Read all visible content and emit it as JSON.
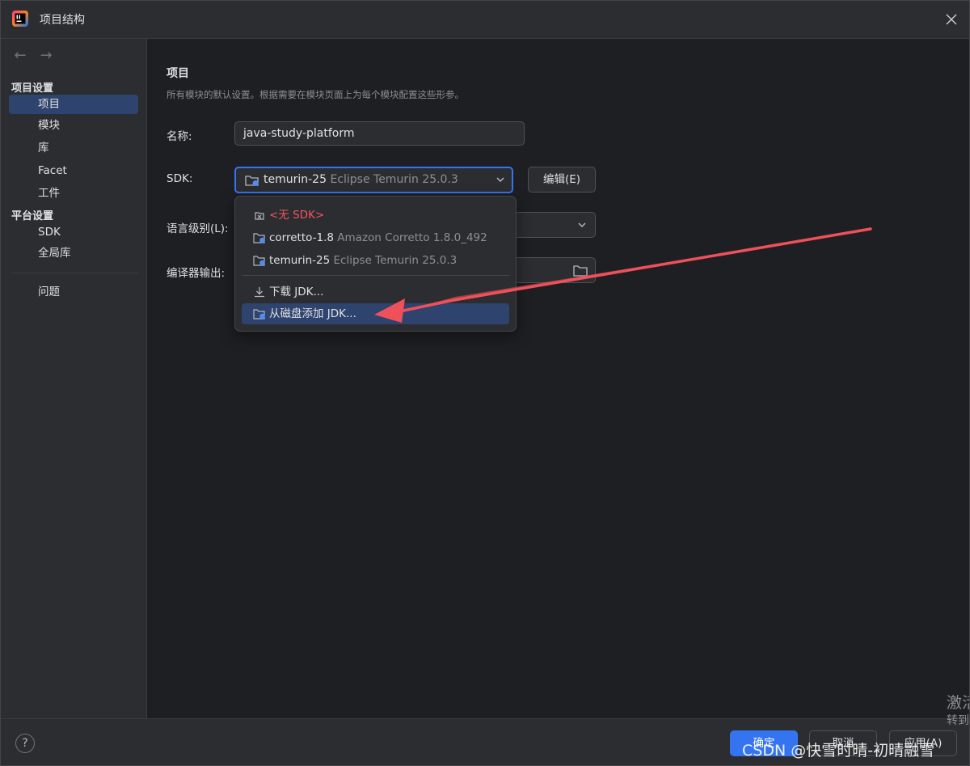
{
  "window": {
    "title": "项目结构"
  },
  "sidebar": {
    "back": "←",
    "forward": "→",
    "group_project_settings": "项目设置",
    "group_platform_settings": "平台设置",
    "items": [
      {
        "label": "项目"
      },
      {
        "label": "模块"
      },
      {
        "label": "库"
      },
      {
        "label": "Facet"
      },
      {
        "label": "工件"
      },
      {
        "label": "SDK"
      },
      {
        "label": "全局库"
      },
      {
        "label": "问题"
      }
    ]
  },
  "main": {
    "title": "项目",
    "description": "所有模块的默认设置。根据需要在模块页面上为每个模块配置这些形参。",
    "name_label": "名称:",
    "name_value": "java-study-platform",
    "sdk_label": "SDK:",
    "sdk_selected_name": "temurin-25",
    "sdk_selected_detail": "Eclipse Temurin 25.0.3",
    "edit_button": "编辑(E)",
    "language_level_label": "语言级别(L):",
    "compiler_output_label": "编译器输出:"
  },
  "sdk_dropdown": {
    "items": [
      {
        "name": "<无 SDK>",
        "detail": ""
      },
      {
        "name": "corretto-1.8",
        "detail": "Amazon Corretto 1.8.0_492"
      },
      {
        "name": "temurin-25",
        "detail": "Eclipse Temurin 25.0.3"
      }
    ],
    "download": "下载 JDK...",
    "add_from_disk": "从磁盘添加 JDK..."
  },
  "footer": {
    "help": "?",
    "ok": "确定",
    "cancel": "取消",
    "apply": "应用(A)"
  },
  "overlay": {
    "watermark": "CSDN @快雪时晴-初晴融雪",
    "activate_line1": "激活",
    "activate_line2": "转到"
  },
  "colors": {
    "accent": "#3574f0",
    "selection": "#2e436e",
    "annotation_arrow": "#f0505a"
  }
}
